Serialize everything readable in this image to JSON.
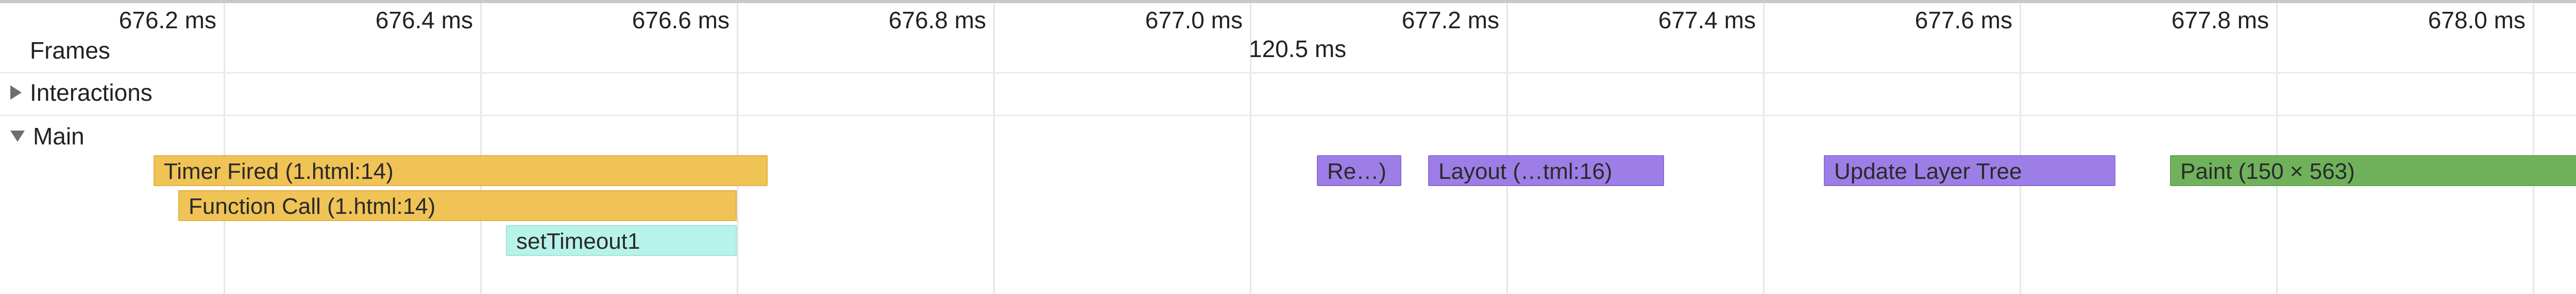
{
  "ruler": {
    "ticks": [
      {
        "label": "676.2 ms"
      },
      {
        "label": "676.4 ms"
      },
      {
        "label": "676.6 ms"
      },
      {
        "label": "676.8 ms"
      },
      {
        "label": "677.0 ms"
      },
      {
        "label": "677.2 ms"
      },
      {
        "label": "677.4 ms"
      },
      {
        "label": "677.6 ms"
      },
      {
        "label": "677.8 ms"
      },
      {
        "label": "678.0 ms"
      }
    ]
  },
  "tracks": {
    "frames": {
      "label": "Frames",
      "duration": "120.5 ms"
    },
    "interactions": {
      "label": "Interactions",
      "expanded": false
    },
    "main": {
      "label": "Main",
      "expanded": true,
      "events": [
        {
          "label": "Timer Fired (1.html:14)",
          "category": "scripting",
          "depth": 0
        },
        {
          "label": "Function Call (1.html:14)",
          "category": "scripting",
          "depth": 1
        },
        {
          "label": "setTimeout1",
          "category": "js",
          "depth": 2
        },
        {
          "label": "Re…)",
          "category": "layout",
          "depth": 0
        },
        {
          "label": "Layout (…tml:16)",
          "category": "layout",
          "depth": 0
        },
        {
          "label": "Update Layer Tree",
          "category": "layout",
          "depth": 0
        },
        {
          "label": "Paint (150 × 563)",
          "category": "paint",
          "depth": 0
        }
      ]
    }
  },
  "colors": {
    "scripting": "#f0c356",
    "js": "#b8f3ea",
    "layout": "#9d7ee6",
    "paint": "#6fb25b"
  }
}
